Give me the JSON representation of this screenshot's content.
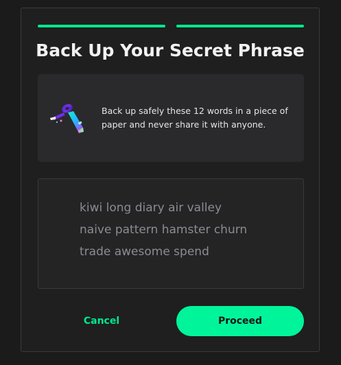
{
  "progress": {
    "total_steps": 2,
    "active_steps": 2
  },
  "title": "Back Up Your Secret Phrase",
  "info": {
    "icon": "key-icon",
    "text": "Back up safely these 12 words in a piece of paper and never share it with anyone."
  },
  "phrase": {
    "lines": [
      "kiwi long diary air valley",
      "naive pattern hamster churn",
      "trade awesome spend"
    ]
  },
  "buttons": {
    "cancel_label": "Cancel",
    "proceed_label": "Proceed"
  },
  "colors": {
    "accent": "#00f59b",
    "background": "#1b1b1b",
    "panel": "#2a2a2c"
  }
}
